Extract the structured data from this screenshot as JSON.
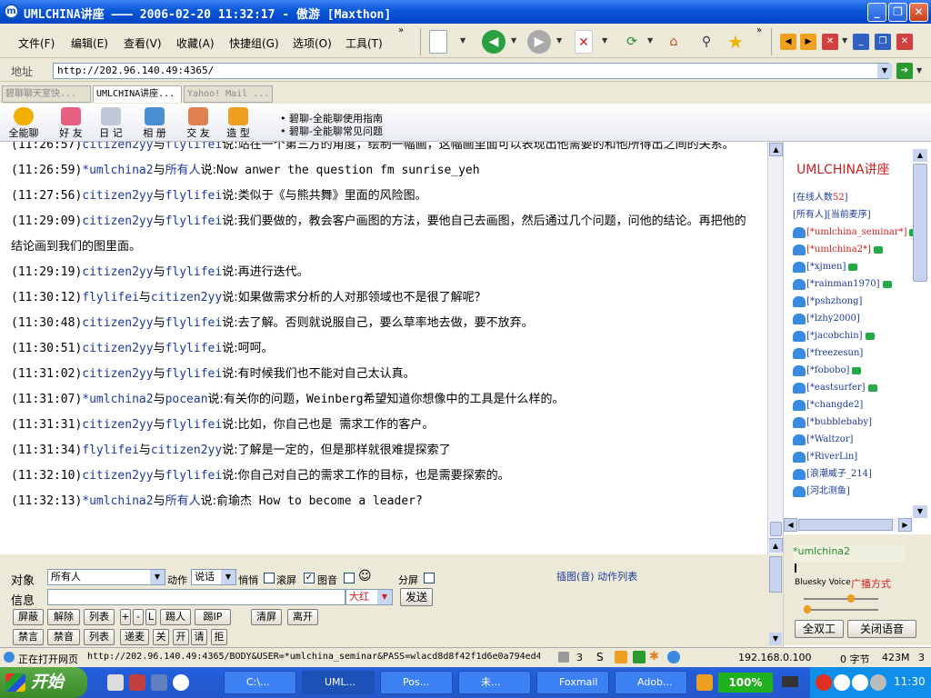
{
  "window": {
    "title": "UMLCHINA讲座 ——— 2006-02-20 11:32:17 - 傲游 [Maxthon]"
  },
  "menu": [
    "文件(F)",
    "编辑(E)",
    "查看(V)",
    "收藏(A)",
    "快捷组(G)",
    "选项(O)",
    "工具(T)"
  ],
  "address": {
    "label": "地址",
    "url": "http://202.96.140.49:4365/"
  },
  "tabs": [
    "碧聊聊天室快...",
    "UMLCHINA讲座...",
    "Yahoo! Mail ..."
  ],
  "apptoolbar": {
    "buttons": [
      "全能聊",
      "好 友",
      "日 记",
      "相 册",
      "交 友",
      "造 型"
    ],
    "guides": [
      "• 碧聊-全能聊使用指南",
      "• 碧聊-全能聊常见问题"
    ]
  },
  "chat": [
    {
      "time": "(11:26:57)",
      "from": "citizen2yy",
      "mid": "与",
      "to": "flylifei",
      "say": "说:",
      "text": "站在一个第三方的角度，绘制一幅画，这幅画里面可以表现出他需要的和他所得出之间的关系。"
    },
    {
      "time": "(11:26:59)",
      "from": "*umlchina2",
      "mid": "与",
      "to": "所有人",
      "say": "说:",
      "text": "Now anwer the question fm sunrise_yeh"
    },
    {
      "time": "(11:27:56)",
      "from": "citizen2yy",
      "mid": "与",
      "to": "flylifei",
      "say": "说:",
      "text": "类似于《与熊共舞》里面的风险图。"
    },
    {
      "time": "(11:29:09)",
      "from": "citizen2yy",
      "mid": "与",
      "to": "flylifei",
      "say": "说:",
      "text": "我们要做的，教会客户画图的方法，要他自己去画图，然后通过几个问题，问他的结论。再把他的结论画到我们的图里面。"
    },
    {
      "time": "(11:29:19)",
      "from": "citizen2yy",
      "mid": "与",
      "to": "flylifei",
      "say": "说:",
      "text": "再进行迭代。"
    },
    {
      "time": "(11:30:12)",
      "from": "flylifei",
      "mid": "与",
      "to": "citizen2yy",
      "say": "说:",
      "text": "如果做需求分析的人对那领域也不是很了解呢？"
    },
    {
      "time": "(11:30:48)",
      "from": "citizen2yy",
      "mid": "与",
      "to": "flylifei",
      "say": "说:",
      "text": "去了解。否则就说服自己，要么草率地去做，要不放弃。"
    },
    {
      "time": "(11:30:51)",
      "from": "citizen2yy",
      "mid": "与",
      "to": "flylifei",
      "say": "说:",
      "text": "呵呵。"
    },
    {
      "time": "(11:31:02)",
      "from": "citizen2yy",
      "mid": "与",
      "to": "flylifei",
      "say": "说:",
      "text": "有时候我们也不能对自己太认真。"
    },
    {
      "time": "(11:31:07)",
      "from": "*umlchina2",
      "mid": "与",
      "to": "pocean",
      "say": "说:",
      "text": "有关你的问题，Weinberg希望知道你想像中的工具是什么样的。"
    },
    {
      "time": "(11:31:31)",
      "from": "citizen2yy",
      "mid": "与",
      "to": "flylifei",
      "say": "说:",
      "text": "比如，你自己也是 需求工作的客户。"
    },
    {
      "time": "(11:31:34)",
      "from": "flylifei",
      "mid": "与",
      "to": "citizen2yy",
      "say": "说:",
      "text": "了解是一定的，但是那样就很难提探索了"
    },
    {
      "time": "(11:32:10)",
      "from": "citizen2yy",
      "mid": "与",
      "to": "flylifei",
      "say": "说:",
      "text": "你自己对自己的需求工作的目标，也是需要探索的。"
    },
    {
      "time": "(11:32:13)",
      "from": "*umlchina2",
      "mid": "与",
      "to": "所有人",
      "say": "说:",
      "text": "俞瑜杰 How to become a leader?"
    }
  ],
  "sidebar": {
    "room_title": "UMLCHINA讲座",
    "online_label": "[在线人数",
    "online_count": "52",
    "online_close": "]",
    "links": "[所有人][当前麦序]",
    "users": [
      "[*umlchina_seminar*]",
      "[*umlchina2*]",
      "[*xjmen]",
      "[*rainman1970]",
      "[*pshzhong]",
      "[*lzhy2000]",
      "[*jacobchin]",
      "[*freezesun]",
      "[*fobobo]",
      "[*eastsurfer]",
      "[*changde2]",
      "[*bubblebaby]",
      "[*Waltzor]",
      "[*RiverLin]",
      "[浪潮威子_214]",
      "[河北测鱼]"
    ],
    "self_name": "*umlchina2",
    "bluesky": "Bluesky Voice",
    "broadcast": "广播方式",
    "btn_duplex": "全双工",
    "btn_close_voice": "关闭语音"
  },
  "input": {
    "target_label": "对象",
    "target_value": "所有人",
    "action_label": "动作",
    "action_value": "说话",
    "whisper": "悄悄",
    "scroll": "滚屏",
    "picture": "图音",
    "split": "分屏",
    "insert_link": "插图(音) 动作列表",
    "info_label": "信息",
    "color_value": "大红",
    "send": "发送",
    "row1": [
      "屏蔽",
      "解除",
      "列表",
      "+",
      "-",
      "L",
      "踢人",
      "踢IP",
      "清屏",
      "离开"
    ],
    "row2": [
      "禁言",
      "禁音",
      "列表",
      "递麦",
      "关",
      "开",
      "请",
      "拒"
    ]
  },
  "status": {
    "loading": "正在打开网页",
    "url": "http://202.96.140.49:4365/BODY&USER=*umlchina_seminar&PASS=wlacd8d8f42f1d6e0a794ed4",
    "count": "3",
    "ip": "192.168.0.100",
    "bytes": "0 字节",
    "mem": "423M",
    "tabs": "3"
  },
  "taskbar": {
    "start": "开始",
    "tasks": [
      "C:\\...",
      "UML...",
      "Pos...",
      "未...",
      "Foxmail",
      "Adob..."
    ],
    "battery": "100%",
    "clock": "11:30"
  }
}
